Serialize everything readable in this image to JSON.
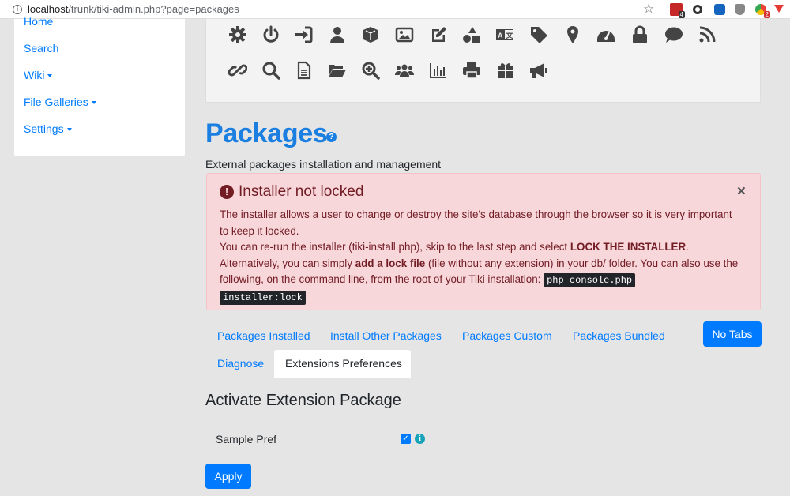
{
  "browser": {
    "url_host": "localhost",
    "url_path": "/trunk/tiki-admin.php?page=packages",
    "ext_badge1": "4",
    "ext_badge2": "2"
  },
  "sidebar": {
    "items": [
      {
        "label": "Home"
      },
      {
        "label": "Search"
      },
      {
        "label": "Wiki"
      },
      {
        "label": "File Galleries"
      },
      {
        "label": "Settings"
      }
    ]
  },
  "icon_panel": {
    "row1": [
      "gear-icon",
      "power-icon",
      "sign-in-icon",
      "user-icon",
      "cube-icon",
      "image-icon",
      "edit-icon",
      "shapes-icon",
      "language-icon",
      "tag-icon",
      "map-marker-icon",
      "dashboard-icon",
      "lock-icon",
      "comment-icon",
      "rss-icon"
    ],
    "row2": [
      "link-icon",
      "search-icon",
      "file-text-icon",
      "folder-open-icon",
      "zoom-in-icon",
      "users-icon",
      "chart-bar-icon",
      "print-icon",
      "gift-icon",
      "bullhorn-icon"
    ]
  },
  "page": {
    "title": "Packages",
    "help": "?",
    "description": "External packages installation and management"
  },
  "alert": {
    "title": "Installer not locked",
    "close": "×",
    "line1": "The installer allows a user to change or destroy the site's database through the browser so it is very important to keep it locked.",
    "line2_pre": "You can re-run the installer (tiki-install.php), skip to the last step and select ",
    "line2_bold": "LOCK THE INSTALLER",
    "line2_post": ".",
    "line3_pre": "Alternatively, you can simply ",
    "line3_bold": "add a lock file",
    "line3_post": " (file without any extension) in your db/ folder. You can also use the following, on the command line, from the root of your Tiki installation: ",
    "command1": "php console.php",
    "command2": "installer:lock"
  },
  "tabs": {
    "items": [
      "Packages Installed",
      "Install Other Packages",
      "Packages Custom",
      "Packages Bundled"
    ],
    "no_tabs": "No Tabs",
    "diagnose": "Diagnose",
    "active": "Extensions Preferences"
  },
  "section": {
    "heading": "Activate Extension Package",
    "pref_label": "Sample Pref",
    "pref_checked": true,
    "apply": "Apply"
  },
  "colors": {
    "link": "#007bff",
    "title": "#1a7fe0",
    "alert_bg": "#f8d7da",
    "alert_text": "#721c24"
  }
}
